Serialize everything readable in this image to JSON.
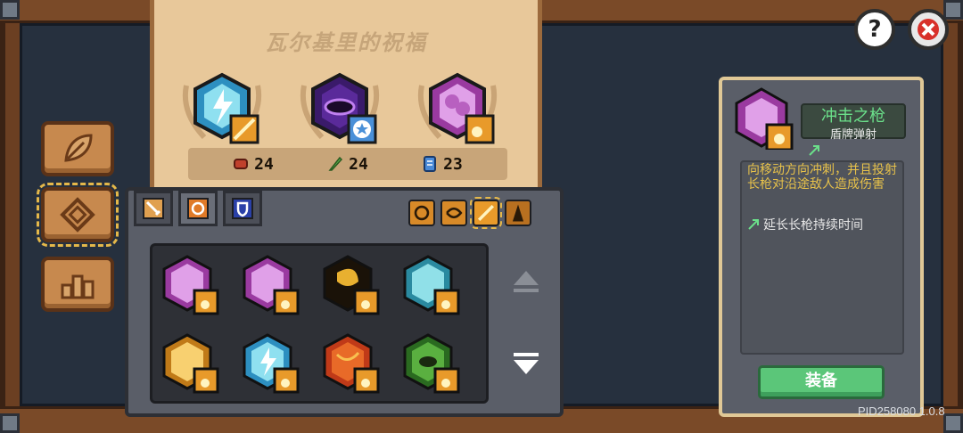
{
  "blessing": {
    "title": "瓦尔基里的祝福",
    "stats": [
      {
        "icon": "fist-icon",
        "value": "24",
        "color": "#c0402c"
      },
      {
        "icon": "feather-icon",
        "value": "24",
        "color": "#5ab04a"
      },
      {
        "icon": "book-icon",
        "value": "23",
        "color": "#4a8ad8"
      }
    ]
  },
  "nav": {
    "items": [
      {
        "name": "leaf-icon"
      },
      {
        "name": "diamond-icon"
      },
      {
        "name": "podium-icon"
      }
    ]
  },
  "detail": {
    "name": "冲击之枪",
    "subtitle": "盾牌弹射",
    "description": "向移动方向冲刺，并且投射长枪对沿途敌人造成伤害",
    "upgrade": "延长长枪持续时间",
    "equip_label": "装备"
  },
  "top": {
    "help_label": "?",
    "close_label": ""
  },
  "version": "PID258080 1.0.8",
  "colors": {
    "accent_gold": "#e5b84a",
    "title_green": "#6be08a",
    "desc_yellow": "#e8c24a",
    "equip_green": "#5bc679"
  }
}
